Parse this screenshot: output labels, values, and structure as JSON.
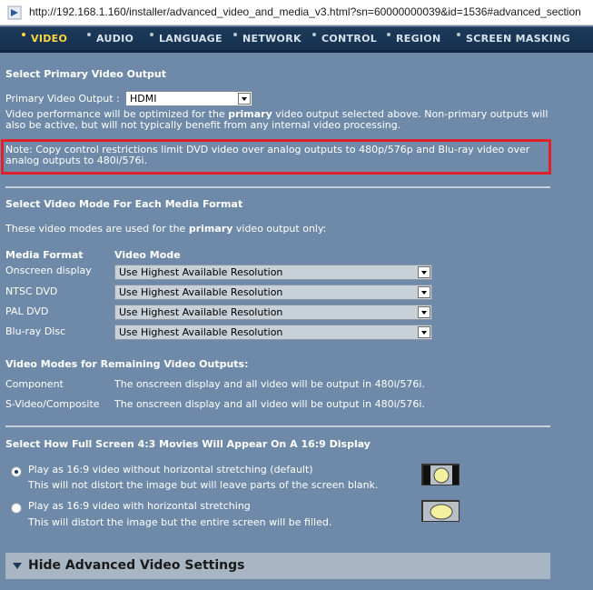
{
  "browser": {
    "url": "http://192.168.1.160/installer/advanced_video_and_media_v3.html?sn=60000000039&id=1536#advanced_section"
  },
  "nav": {
    "tabs": [
      "VIDEO",
      "AUDIO",
      "LANGUAGE",
      "NETWORK",
      "CONTROL",
      "REGION",
      "SCREEN MASKING"
    ],
    "active": "VIDEO",
    "colors": {
      "active": "#ffd640",
      "inactive": "#d8e2ec"
    }
  },
  "primary": {
    "heading": "Select Primary Video Output",
    "label": "Primary Video Output :",
    "value": "HDMI",
    "desc_pre": "Video performance will be optimized for the ",
    "desc_bold": "primary",
    "desc_post": " video output selected above. Non-primary outputs will also be active, but will not typically benefit from any internal video processing.",
    "note": "Note: Copy control restrictions limit DVD video over analog outputs to 480p/576p and Blu-ray video over analog outputs to 480i/576i."
  },
  "modes": {
    "heading": "Select Video Mode For Each Media Format",
    "desc_pre": "These video modes are used for the ",
    "desc_bold": "primary",
    "desc_post": " video output only:",
    "col_format": "Media Format",
    "col_mode": "Video Mode",
    "rows": [
      {
        "format": "Onscreen display",
        "mode": "Use Highest Available Resolution"
      },
      {
        "format": "NTSC DVD",
        "mode": "Use Highest Available Resolution"
      },
      {
        "format": "PAL DVD",
        "mode": "Use Highest Available Resolution"
      },
      {
        "format": "Blu-ray Disc",
        "mode": "Use Highest Available Resolution"
      }
    ]
  },
  "remaining": {
    "heading": "Video Modes for Remaining Video Outputs:",
    "rows": [
      {
        "output": "Component",
        "desc": "The onscreen display and all video will be output in 480i/576i."
      },
      {
        "output": "S-Video/Composite",
        "desc": "The onscreen display and all video will be output in 480i/576i."
      }
    ]
  },
  "aspect": {
    "heading": "Select How Full Screen 4:3 Movies Will Appear On A 16:9 Display",
    "options": [
      {
        "label": "Play as 16:9 video without horizontal stretching (default)",
        "desc": "This will not distort the image but will leave parts of the screen blank.",
        "selected": true
      },
      {
        "label": "Play as 16:9 video with horizontal stretching",
        "desc": "This will distort the image but the entire screen will be filled.",
        "selected": false
      }
    ]
  },
  "footer": {
    "hide_label": "Hide Advanced Video Settings"
  }
}
